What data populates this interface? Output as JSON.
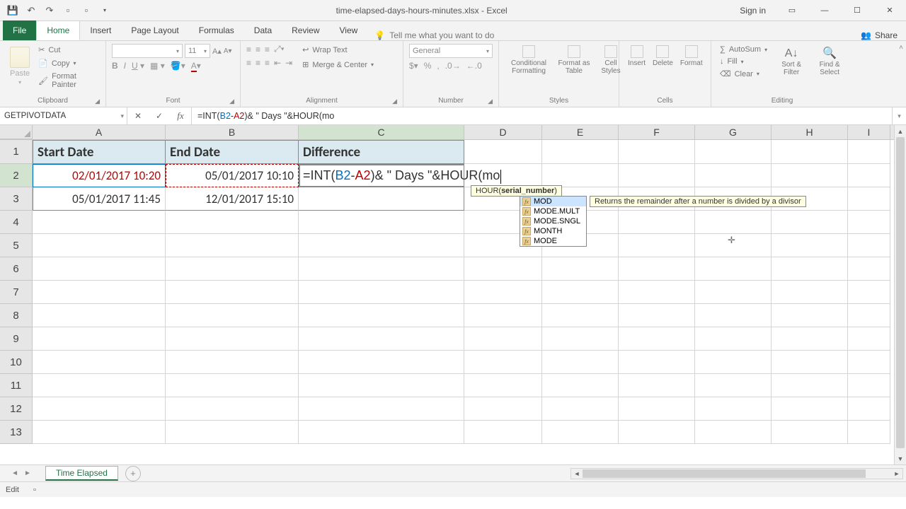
{
  "titlebar": {
    "title": "time-elapsed-days-hours-minutes.xlsx - Excel",
    "signin": "Sign in"
  },
  "tabs": {
    "file": "File",
    "home": "Home",
    "insert": "Insert",
    "pagelayout": "Page Layout",
    "formulas": "Formulas",
    "data": "Data",
    "review": "Review",
    "view": "View",
    "tellme": "Tell me what you want to do",
    "share": "Share"
  },
  "ribbon": {
    "clipboard": {
      "paste": "Paste",
      "cut": "Cut",
      "copy": "Copy",
      "fmtpainter": "Format Painter",
      "label": "Clipboard"
    },
    "font": {
      "size": "11",
      "label": "Font"
    },
    "alignment": {
      "wrap": "Wrap Text",
      "merge": "Merge & Center",
      "label": "Alignment"
    },
    "number": {
      "format": "General",
      "label": "Number"
    },
    "styles": {
      "cond": "Conditional Formatting",
      "table": "Format as Table",
      "cell": "Cell Styles",
      "label": "Styles"
    },
    "cells": {
      "insert": "Insert",
      "delete": "Delete",
      "format": "Format",
      "label": "Cells"
    },
    "editing": {
      "autosum": "AutoSum",
      "fill": "Fill",
      "clear": "Clear",
      "sort": "Sort & Filter",
      "find": "Find & Select",
      "label": "Editing"
    }
  },
  "fbar": {
    "namebox": "GETPIVOTDATA",
    "formula_prefix": "=INT(",
    "ref_b2": "B2",
    "dash": "-",
    "ref_a2": "A2",
    "formula_mid": ")& \" Days \"&HOUR(mo"
  },
  "columns": {
    "A": "A",
    "B": "B",
    "C": "C",
    "D": "D",
    "E": "E",
    "F": "F",
    "G": "G",
    "H": "H",
    "I": "I"
  },
  "headers": {
    "A": "Start Date",
    "B": "End Date",
    "C": "Difference"
  },
  "data": {
    "r2": {
      "A": "02/01/2017 10:20",
      "B": "05/01/2017 10:10"
    },
    "r3": {
      "A": "05/01/2017 11:45",
      "B": "12/01/2017 15:10"
    }
  },
  "cellFormula": {
    "text": "=INT(",
    "b2": "B2",
    "dash": "-",
    "a2": "A2",
    "rest": ")& \" Days \"&HOUR(mo"
  },
  "tooltip": {
    "fn": "HOUR(",
    "arg": "serial_number",
    "close": ")"
  },
  "autocomplete": {
    "items": [
      "MOD",
      "MODE.MULT",
      "MODE.SNGL",
      "MONTH",
      "MODE"
    ],
    "desc": "Returns the remainder after a number is divided by a divisor"
  },
  "sheet": {
    "name": "Time Elapsed"
  },
  "status": {
    "mode": "Edit"
  }
}
